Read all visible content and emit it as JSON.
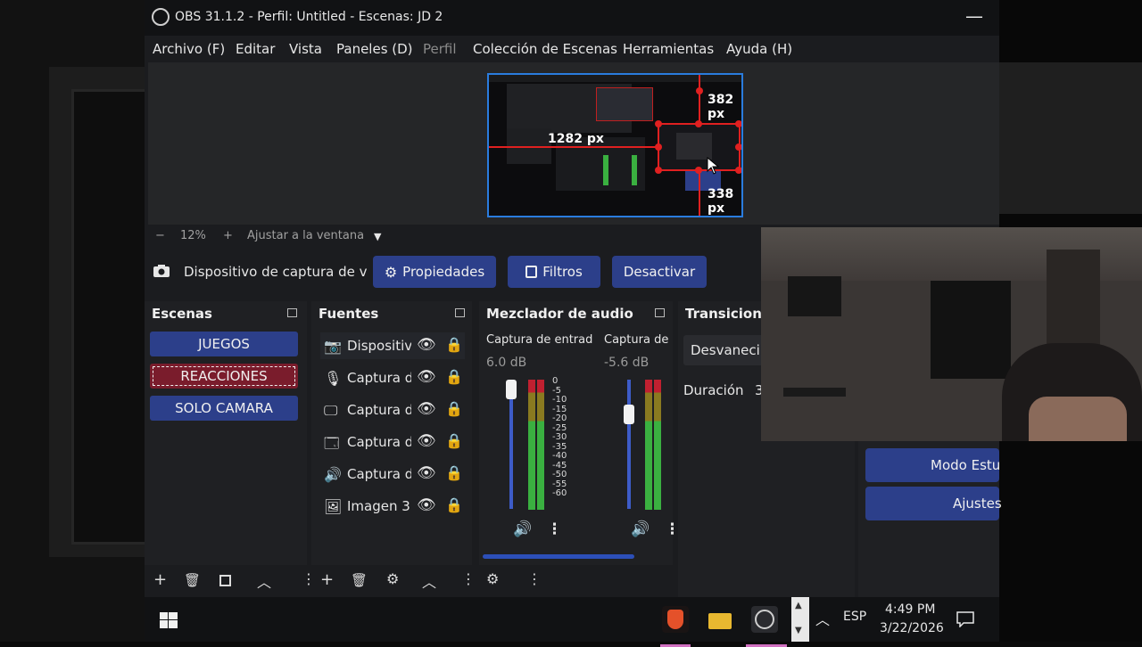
{
  "window": {
    "title": "OBS 31.1.2 - Perfil: Untitled - Escenas: JD 2",
    "minimize_label": "—"
  },
  "menu": {
    "items": [
      {
        "label": "Archivo (F)",
        "enabled": true
      },
      {
        "label": "Editar",
        "enabled": true
      },
      {
        "label": "Vista",
        "enabled": true
      },
      {
        "label": "Paneles (D)",
        "enabled": true
      },
      {
        "label": "Perfil",
        "enabled": false
      },
      {
        "label": "Colección de Escenas",
        "enabled": true
      },
      {
        "label": "Herramientas",
        "enabled": true
      },
      {
        "label": "Ayuda (H)",
        "enabled": true
      }
    ]
  },
  "preview": {
    "width_label": "1282 px",
    "top_label": "382 px",
    "bottom_label": "338 px"
  },
  "zoom": {
    "minus": "−",
    "level": "12%",
    "plus": "+",
    "fit_label": "Ajustar a la ventana",
    "dropdown_icon": "▼"
  },
  "source_toolbar": {
    "source_name": "Dispositivo de captura de v",
    "properties_label": "Propiedades",
    "filters_label": "Filtros",
    "deactivate_label": "Desactivar"
  },
  "scenes": {
    "title": "Escenas",
    "items": [
      {
        "label": "JUEGOS",
        "active": false
      },
      {
        "label": "REACCIONES",
        "active": true
      },
      {
        "label": "SOLO CAMARA",
        "active": false
      }
    ]
  },
  "sources": {
    "title": "Fuentes",
    "items": [
      {
        "label": "Dispositiv",
        "icon": "camera-icon"
      },
      {
        "label": "Captura d",
        "icon": "microphone-icon"
      },
      {
        "label": "Captura d",
        "icon": "monitor-icon"
      },
      {
        "label": "Captura d",
        "icon": "window-icon"
      },
      {
        "label": "Captura d",
        "icon": "speaker-icon"
      },
      {
        "label": "Imagen 3",
        "icon": "image-icon"
      }
    ]
  },
  "mixer": {
    "title": "Mezclador de audio",
    "channels": [
      {
        "name": "Captura de entrada",
        "db": "6.0 dB"
      },
      {
        "name": "Captura de s",
        "db": "-5.6 dB"
      }
    ],
    "scale": [
      "0",
      "-5",
      "-10",
      "-15",
      "-20",
      "-25",
      "-30",
      "-35",
      "-40",
      "-45",
      "-50",
      "-55",
      "-60"
    ]
  },
  "transitions": {
    "title": "Transicione",
    "type_label": "Desvanecir",
    "duration_label": "Duración",
    "duration_value": "3"
  },
  "controls": {
    "studio_mode_label": "Modo Estu",
    "settings_label": "Ajustes"
  },
  "taskbar": {
    "language": "ESP",
    "time": "4:49 PM",
    "date": "3/22/2026"
  },
  "colors": {
    "accent_blue": "#2c3f8a",
    "active_scene": "#7a1c2c",
    "selection_red": "#e02020",
    "preview_border": "#2a7cde"
  }
}
